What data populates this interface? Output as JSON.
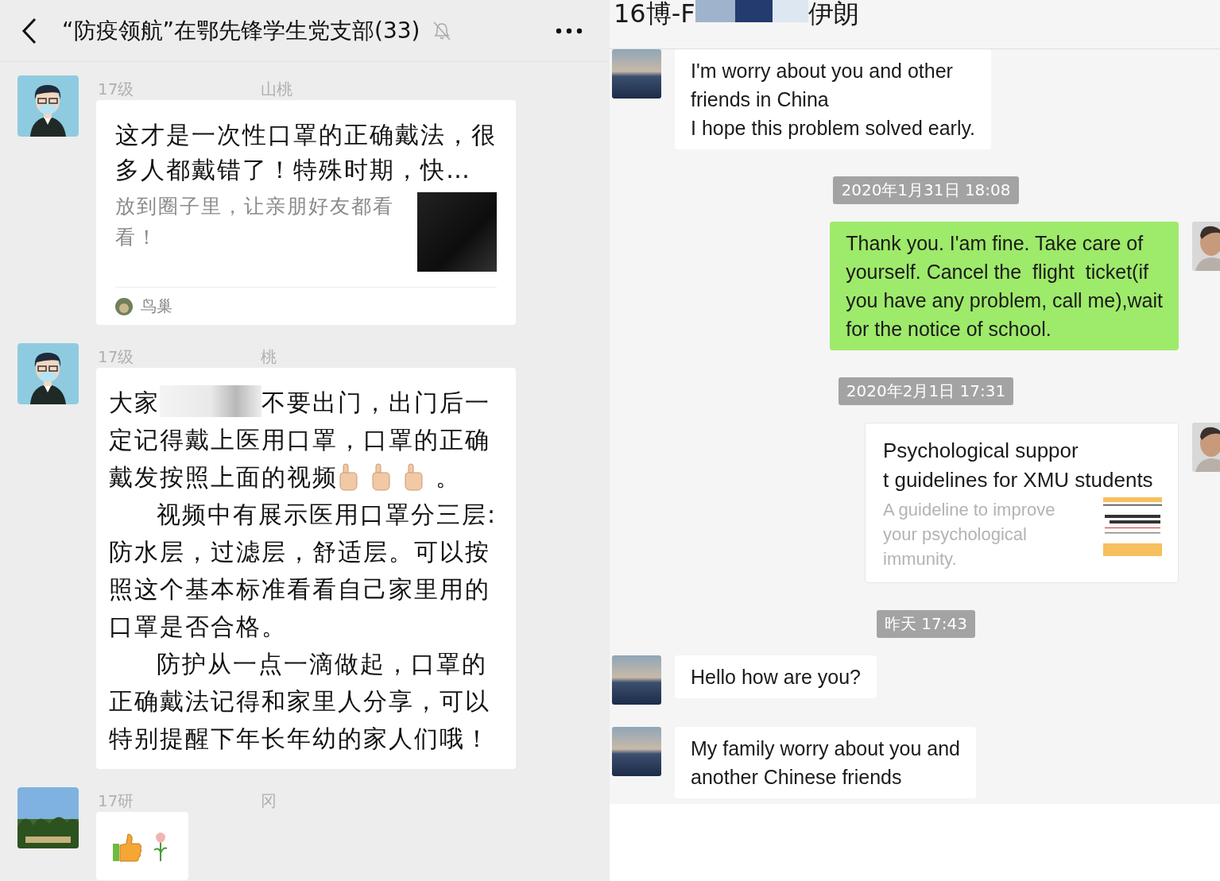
{
  "left_chat": {
    "title": "“防疫领航”在鄂先锋学生党支部(33)",
    "muted": true,
    "messages": [
      {
        "kind": "link_card",
        "sender_prefix": "17级",
        "sender_suffix": "山桃",
        "title": "这才是一次性口罩的正确戴法，很多人都戴错了！特殊时期，快…",
        "description": "放到圈子里，让亲朋好友都看看！",
        "source": "鸟巢"
      },
      {
        "kind": "text",
        "sender_prefix": "17级",
        "sender_suffix": "桃",
        "lead": "大家",
        "lines": [
          "不要出门，出门后一",
          "定记得戴上医用口罩，口罩的正确",
          "戴发按照上面的视频"
        ],
        "trail": "。",
        "paragraphs": [
          "视频中有展示医用口罩分三层:防水层，过滤层，舒适层。可以按照这个基本标准看看自己家里用的口罩是否合格。",
          "防护从一点一滴做起，口罩的正确戴法记得和家里人分享，可以特别提醒下年长年幼的家人们哦！"
        ]
      },
      {
        "kind": "sticker",
        "sender_prefix": "17研",
        "sender_suffix": "冈"
      }
    ]
  },
  "right_chat": {
    "title_prefix": "16博-F",
    "title_suffix": "伊朗",
    "messages": [
      {
        "kind": "text",
        "outgoing": false,
        "text": "I'm worry about you and other\nfriends in China\nI hope this problem solved early."
      },
      {
        "kind": "time",
        "text": "2020年1月31日 18:08"
      },
      {
        "kind": "text",
        "outgoing": true,
        "text": "Thank you. I'am fine. Take care of\nyourself. Cancel the  flight  ticket(if\nyou have any problem, call me),wait\nfor the notice of school."
      },
      {
        "kind": "time",
        "text": "2020年2月1日 17:31"
      },
      {
        "kind": "link_card",
        "outgoing": true,
        "title": "Psychological suppor\nt guidelines for XMU students",
        "description": "A guideline to improve\nyour psychological\nimmunity."
      },
      {
        "kind": "time",
        "text": "昨天 17:43"
      },
      {
        "kind": "text",
        "outgoing": false,
        "text": "Hello how are you?"
      },
      {
        "kind": "text",
        "outgoing": false,
        "text": "My family worry about you and\nanother Chinese friends"
      }
    ]
  }
}
